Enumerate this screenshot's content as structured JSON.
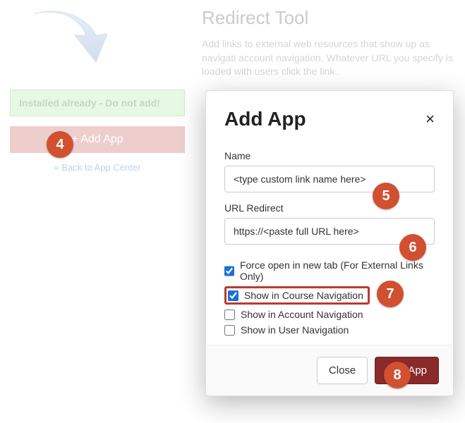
{
  "bg": {
    "installed_msg": "Installed already - Do not add!",
    "add_app_bar": "+ Add App",
    "back_link": "« Back to App Center"
  },
  "redirect": {
    "title": "Redirect Tool",
    "desc": "Add links to external web resources that show up as navigati account navigation. Whatever URL you specify is loaded with users click the link."
  },
  "modal": {
    "title": "Add App",
    "close_x": "×",
    "name_label": "Name",
    "name_value": "<type custom link name here>",
    "url_label": "URL Redirect",
    "url_value": "https://<paste full URL here>",
    "cb_force": "Force open in new tab (For External Links Only)",
    "cb_course": "Show in Course Navigation",
    "cb_account": "Show in Account Navigation",
    "cb_user": "Show in User Navigation",
    "close_btn": "Close",
    "add_btn": "Add App"
  },
  "badges": {
    "b4": "4",
    "b5": "5",
    "b6": "6",
    "b7": "7",
    "b8": "8"
  }
}
